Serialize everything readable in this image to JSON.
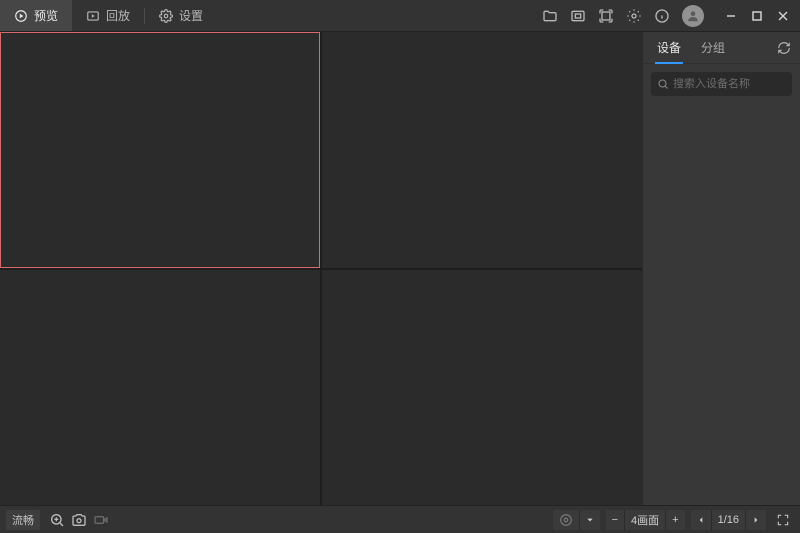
{
  "titlebar": {
    "tabs": [
      {
        "label": "预览",
        "active": true
      },
      {
        "label": "回放",
        "active": false
      },
      {
        "label": "设置",
        "active": false
      }
    ]
  },
  "sidepanel": {
    "tabs": [
      {
        "label": "设备",
        "active": true
      },
      {
        "label": "分组",
        "active": false
      }
    ],
    "search_placeholder": "搜索入设备名称"
  },
  "bottombar": {
    "quality_label": "流畅",
    "layout_label": "4画面",
    "page_label": "1/16"
  }
}
